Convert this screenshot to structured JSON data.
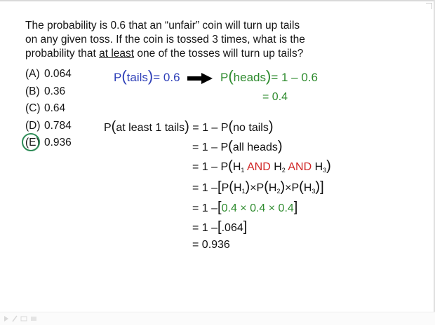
{
  "question": {
    "line1": "The probability is 0.6 that an “unfair” coin will turn up tails",
    "line2": "on any given toss.  If the coin is tossed 3 times, what is the",
    "line3_pre": "probability that ",
    "line3_underlined": "at least",
    "line3_post": " one of the tosses will turn up tails?"
  },
  "choices": [
    {
      "letter": "(A)",
      "value": "0.064",
      "selected": false
    },
    {
      "letter": "(B)",
      "value": "0.36",
      "selected": false
    },
    {
      "letter": "(C)",
      "value": "0.64",
      "selected": false
    },
    {
      "letter": "(D)",
      "value": "0.784",
      "selected": false
    },
    {
      "letter": "(E)",
      "value": "0.936",
      "selected": true
    }
  ],
  "given": {
    "p_tails_label": "P",
    "p_tails_arg": "tails",
    "p_tails_eq": "= 0.6",
    "p_heads_label": "P",
    "p_heads_arg": "heads",
    "p_heads_eq": "= 1 – 0.6",
    "p_heads_result": "= 0.4"
  },
  "steps": {
    "s1_lhs_p": "P",
    "s1_lhs_arg": "at least 1 tails",
    "s1_rhs": "= 1 – P",
    "s1_rhs_arg": "no tails",
    "s2_rhs": "= 1 – P",
    "s2_rhs_arg": "all heads",
    "s3_rhs": "= 1 – P",
    "s3_h1": "H",
    "s3_h1_sub": "1",
    "s3_and1": "AND",
    "s3_h2": "H",
    "s3_h2_sub": "2",
    "s3_and2": "AND",
    "s3_h3": "H",
    "s3_h3_sub": "3",
    "s4_rhs": "= 1 –",
    "s4_p": "P",
    "s4_h": "H",
    "s4_sub1": "1",
    "s4_sub2": "2",
    "s4_sub3": "3",
    "s4_times": "×",
    "s5_rhs": "= 1 –",
    "s5_expr": "0.4 × 0.4 × 0.4",
    "s6_rhs": "= 1 –",
    "s6_val": ".064",
    "s7_rhs": "= 0.936"
  },
  "colors": {
    "blue": "#2e3fb8",
    "green": "#2e8b2e",
    "red": "#d02525",
    "circle": "#2e8b57"
  }
}
